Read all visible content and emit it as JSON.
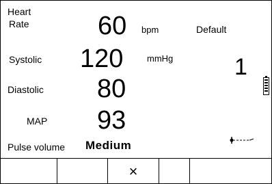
{
  "heart_rate": {
    "label_line1": "Heart",
    "label_line2": "Rate",
    "value": "60",
    "unit": "bpm"
  },
  "mode": {
    "label": "Default"
  },
  "systolic": {
    "label": "Systolic",
    "value": "120",
    "unit": "mmHg"
  },
  "channel": {
    "number": "1"
  },
  "diastolic": {
    "label": "Diastolic",
    "value": "80"
  },
  "map": {
    "label": "MAP",
    "value": "93"
  },
  "pulse_volume": {
    "label": "Pulse volume",
    "value": "Medium"
  },
  "softkeys": [
    "",
    "",
    "×",
    "",
    ""
  ],
  "icons": {
    "battery": "battery-icon",
    "probe": "probe-icon",
    "close": "close-icon"
  }
}
